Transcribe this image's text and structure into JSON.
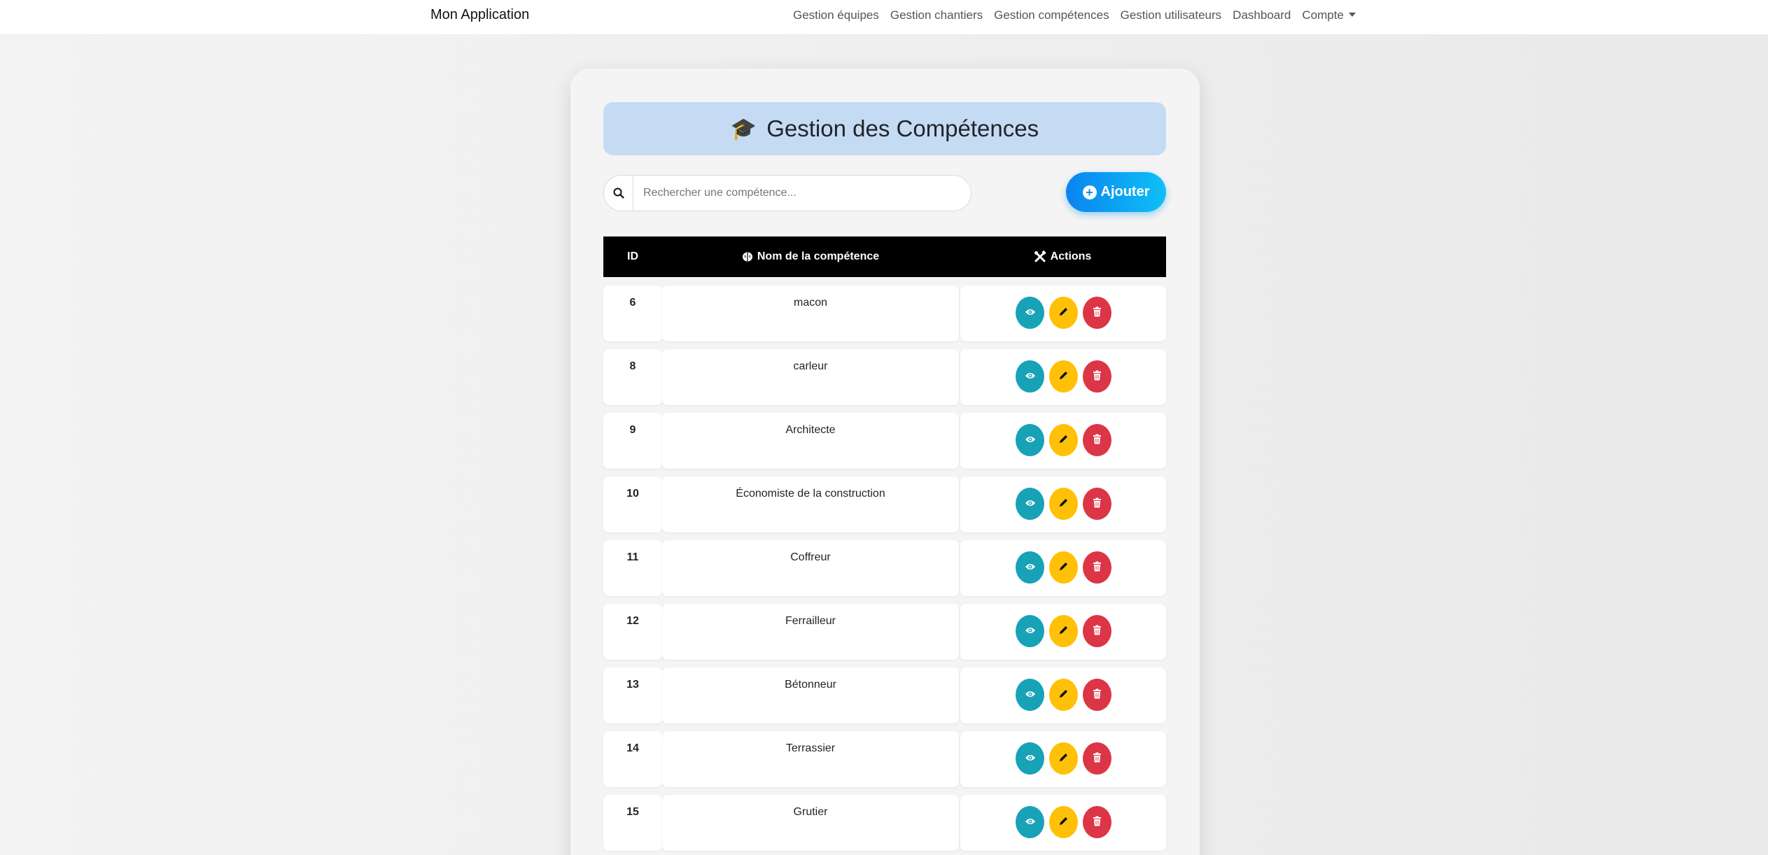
{
  "navbar": {
    "brand": "Mon Application",
    "links": [
      "Gestion équipes",
      "Gestion chantiers",
      "Gestion compétences",
      "Gestion utilisateurs",
      "Dashboard",
      "Compte"
    ]
  },
  "page": {
    "title_icon": "🎓",
    "title": "Gestion des Compétences",
    "search_placeholder": "Rechercher une compétence...",
    "add_label": "Ajouter"
  },
  "table": {
    "headers": {
      "id": "ID",
      "name": "Nom de la compétence",
      "actions": "Actions"
    },
    "rows": [
      {
        "id": "6",
        "name": "macon"
      },
      {
        "id": "8",
        "name": "carleur"
      },
      {
        "id": "9",
        "name": "Architecte"
      },
      {
        "id": "10",
        "name": "Économiste de la construction"
      },
      {
        "id": "11",
        "name": "Coffreur"
      },
      {
        "id": "12",
        "name": "Ferrailleur"
      },
      {
        "id": "13",
        "name": "Bétonneur"
      },
      {
        "id": "14",
        "name": "Terrassier"
      },
      {
        "id": "15",
        "name": "Grutier"
      }
    ]
  },
  "colors": {
    "view": "#17a2b8",
    "edit": "#ffc107",
    "delete": "#dc3545",
    "header_bg": "#000000",
    "title_bg": "#c5dbf4"
  },
  "icons": [
    "search-icon",
    "plus-circle-icon",
    "brain-icon",
    "tools-icon",
    "eye-icon",
    "pencil-icon",
    "trash-icon",
    "graduation-cap-icon",
    "caret-down-icon"
  ]
}
